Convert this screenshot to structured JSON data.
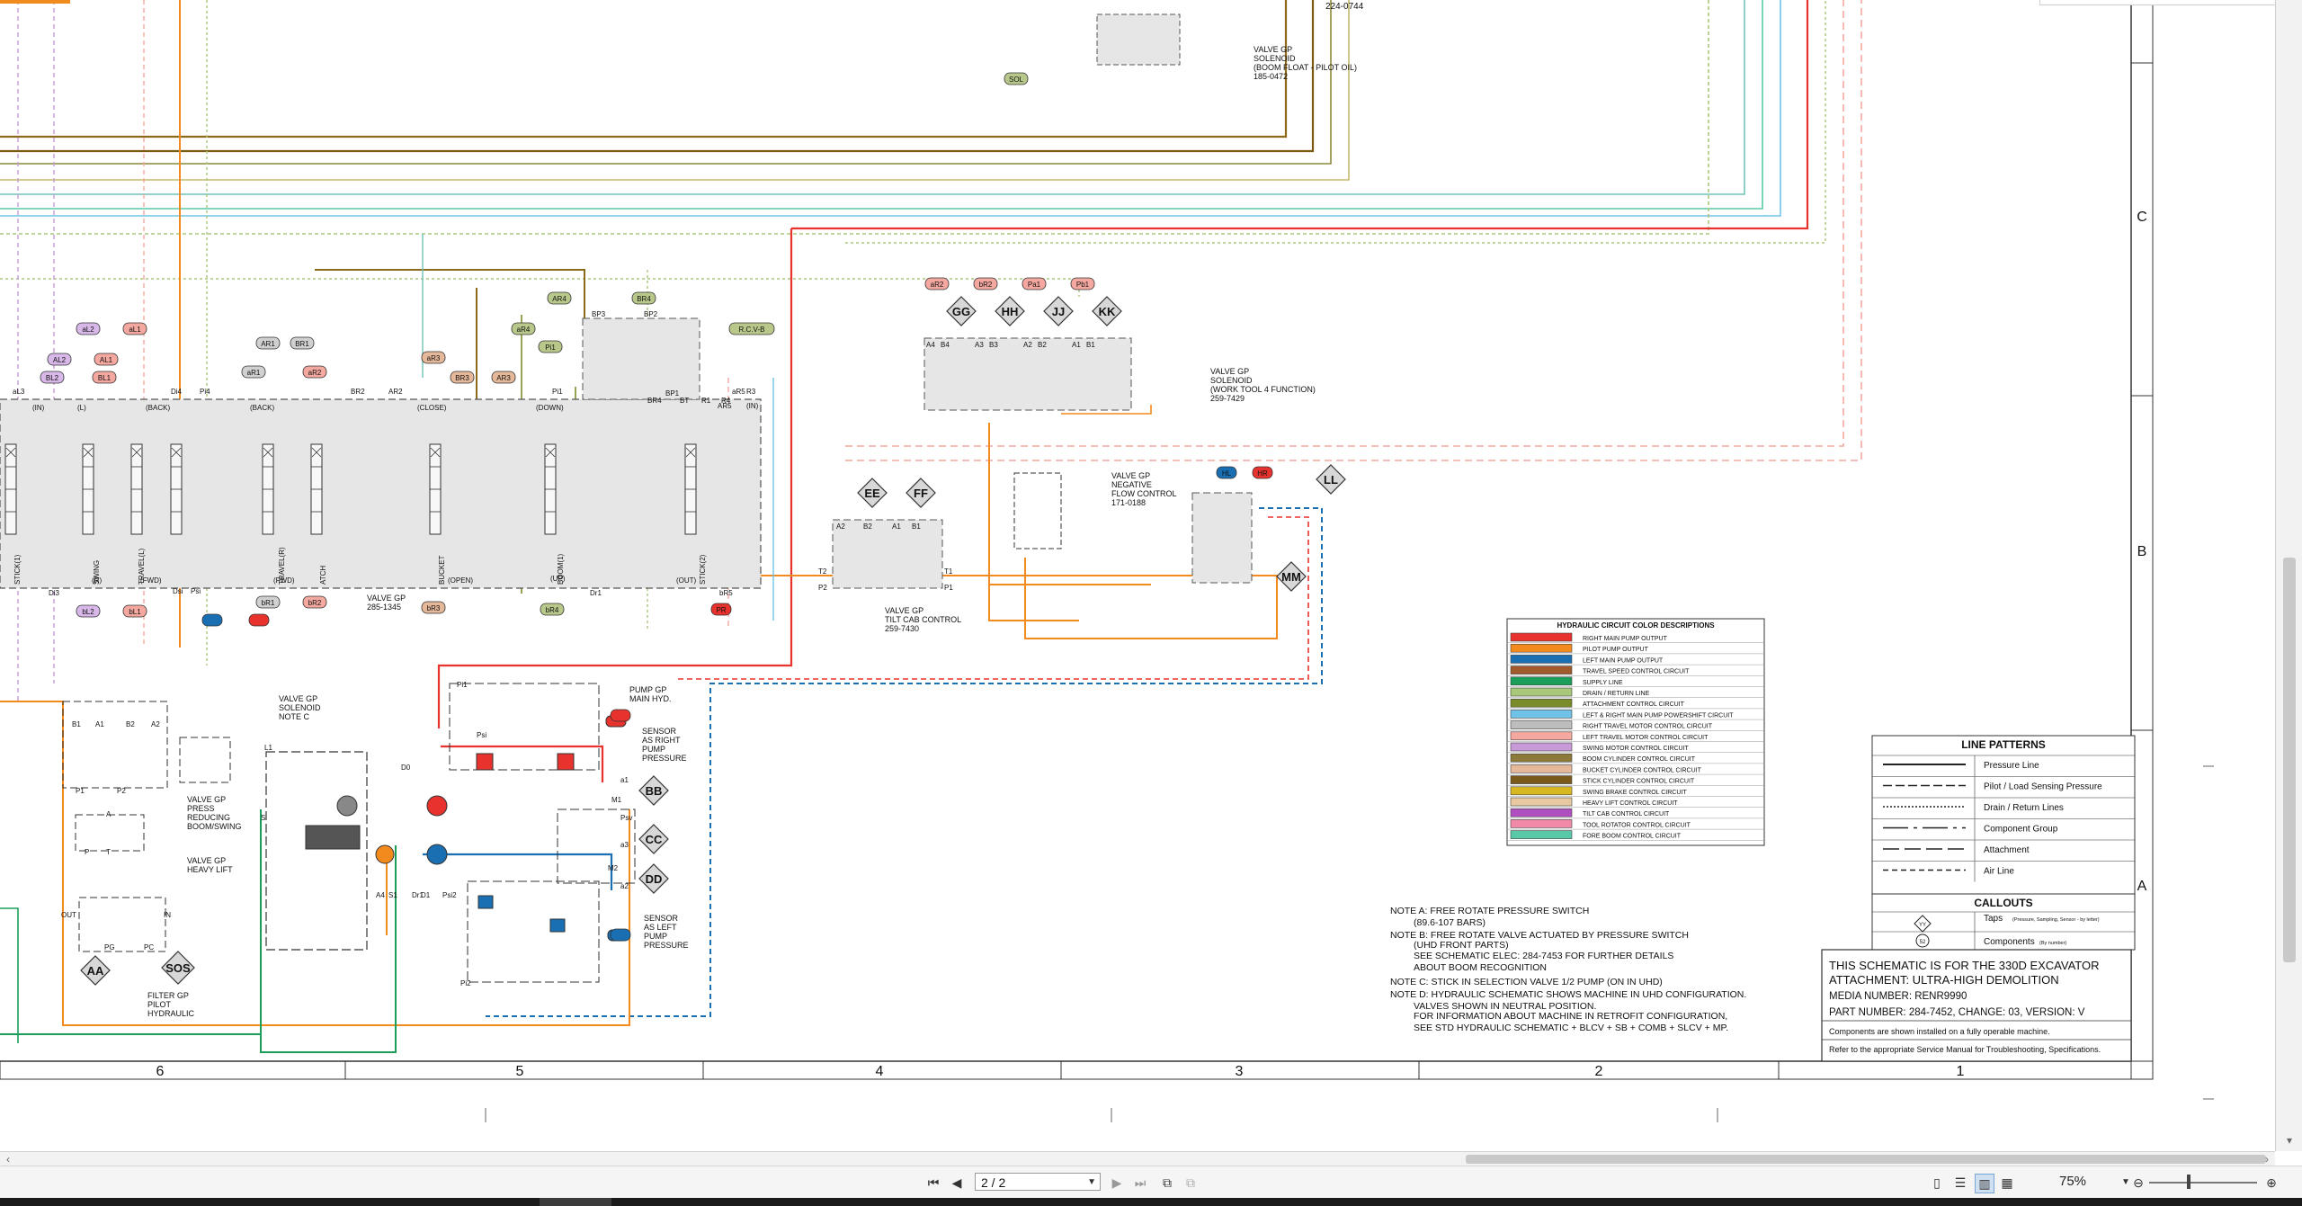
{
  "sheet": {
    "columns": [
      "6",
      "5",
      "4",
      "3",
      "2",
      "1"
    ],
    "rows": [
      "C",
      "B",
      "A"
    ],
    "part_top": "224-0744"
  },
  "components": {
    "boom_float_valve": [
      "VALVE GP",
      "SOLENOID",
      "(BOOM FLOAT - PILOT OIL)",
      "185-0472"
    ],
    "work_tool_valve": [
      "VALVE GP",
      "SOLENOID",
      "(WORK TOOL 4 FUNCTION)",
      "259-7429"
    ],
    "neg_flow_valve": [
      "VALVE GP",
      "NEGATIVE",
      "FLOW CONTROL",
      "171-0188"
    ],
    "tilt_cab_valve": [
      "VALVE GP",
      "TILT CAB CONTROL",
      "259-7430"
    ],
    "main_valve": [
      "VALVE GP",
      "285-1345"
    ],
    "solenoid_note_c": [
      "VALVE GP",
      "SOLENOID",
      "NOTE C"
    ],
    "press_reducing": [
      "VALVE GP",
      "PRESS",
      "REDUCING",
      "BOOM/SWING"
    ],
    "heavy_lift": [
      "VALVE GP",
      "HEAVY LIFT"
    ],
    "filter_pilot": [
      "FILTER GP",
      "PILOT",
      "HYDRAULIC"
    ],
    "pump_main": [
      "PUMP GP",
      "MAIN HYD."
    ],
    "sensor_right": [
      "SENSOR",
      "AS RIGHT",
      "PUMP",
      "PRESSURE"
    ],
    "sensor_left": [
      "SENSOR",
      "AS LEFT",
      "PUMP",
      "PRESSURE"
    ]
  },
  "callouts_diamond": [
    "GG",
    "HH",
    "JJ",
    "KK",
    "EE",
    "FF",
    "LL",
    "MM",
    "BB",
    "CC",
    "DD",
    "AA",
    "SOS"
  ],
  "tags": {
    "wt_top": [
      "aR2",
      "bR2",
      "Pa1",
      "Pb1"
    ],
    "wt_ports": [
      "A4",
      "B4",
      "A3",
      "B3",
      "A2",
      "B2",
      "A1",
      "B1"
    ],
    "tilt_ports": [
      "A2",
      "B2",
      "A1",
      "B1",
      "T2",
      "P2",
      "T1",
      "P1"
    ],
    "neg_top": [
      "HL",
      "HR"
    ],
    "sol": "SOL",
    "mv_top_left": [
      "aL2",
      "aL1",
      "AL2",
      "AL1",
      "BL2",
      "BL1"
    ],
    "mv_top_mid": [
      "AR1",
      "BR1",
      "aR1",
      "aR2",
      "aR3",
      "BR3",
      "AR3",
      "AR4",
      "Pi1",
      "BR4",
      "aR4",
      "R.C.V-B"
    ],
    "mv_bottom": [
      "bL2",
      "bL1",
      "bR1",
      "bR2",
      "bR3",
      "bR4",
      "PR"
    ],
    "mv_labels_top": [
      "aL3",
      "(IN)",
      "(L)",
      "(BACK)",
      "Di4",
      "Pi4",
      "(BACK)",
      "BR2",
      "AR2",
      "(CLOSE)",
      "(DOWN)",
      "Pi1",
      "BP3",
      "BP2",
      "BP1",
      "BR4",
      "BT",
      "R1",
      "R4",
      "R3",
      "AR5",
      "(IN)",
      "aR5"
    ],
    "mv_labels_bottom": [
      "Di3",
      "(R)",
      "(FWD)",
      "Dsi",
      "Psi",
      "(FWD)",
      "(OPEN)",
      "(UP)",
      "Dr1",
      "(OUT)",
      "bR5"
    ],
    "mv_spools": [
      "STICK(1)",
      "SWING",
      "TRAVEL(L)",
      "TRAVEL(R)",
      "ATCH",
      "BUCKET",
      "BOOM(1)",
      "STICK(2)"
    ],
    "pump_ports": [
      "Pi1",
      "Psi",
      "D0",
      "a1",
      "M1",
      "a3",
      "Psv",
      "M2",
      "a2",
      "A4",
      "S1",
      "Dr1",
      "D1",
      "Psi2",
      "Pi2",
      "L1",
      "S"
    ],
    "small": [
      "B1",
      "A1",
      "B2",
      "A2",
      "P1",
      "P2",
      "A",
      "T",
      "P",
      "OUT",
      "IN",
      "PC",
      "PG"
    ]
  },
  "color_table": {
    "title": "HYDRAULIC CIRCUIT COLOR DESCRIPTIONS",
    "rows": [
      {
        "label": "RIGHT MAIN PUMP OUTPUT",
        "color": "#e8322e"
      },
      {
        "label": "PILOT PUMP OUTPUT",
        "color": "#f28a1e"
      },
      {
        "label": "LEFT MAIN PUMP OUTPUT",
        "color": "#1a6fb3"
      },
      {
        "label": "TRAVEL SPEED CONTROL CIRCUIT",
        "color": "#a05a2c"
      },
      {
        "label": "SUPPLY LINE",
        "color": "#1a9e5a"
      },
      {
        "label": "DRAIN / RETURN LINE",
        "color": "#a8c87a"
      },
      {
        "label": "ATTACHMENT CONTROL CIRCUIT",
        "color": "#7a8c2a"
      },
      {
        "label": "LEFT & RIGHT MAIN PUMP POWERSHIFT CIRCUIT",
        "color": "#6fc3e8"
      },
      {
        "label": "RIGHT TRAVEL MOTOR CONTROL CIRCUIT",
        "color": "#bdbdbd"
      },
      {
        "label": "LEFT TRAVEL MOTOR CONTROL CIRCUIT",
        "color": "#f4a8a0"
      },
      {
        "label": "SWING MOTOR CONTROL CIRCUIT",
        "color": "#c89ad8"
      },
      {
        "label": "BOOM CYLINDER CONTROL CIRCUIT",
        "color": "#8c7a3a"
      },
      {
        "label": "BUCKET CYLINDER CONTROL CIRCUIT",
        "color": "#e6b89a"
      },
      {
        "label": "STICK CYLINDER CONTROL CIRCUIT",
        "color": "#7a5a1a"
      },
      {
        "label": "SWING BRAKE CONTROL CIRCUIT",
        "color": "#d8b820"
      },
      {
        "label": "HEAVY LIFT CONTROL CIRCUIT",
        "color": "#e8c8a0"
      },
      {
        "label": "TILT CAB CONTROL CIRCUIT",
        "color": "#b050c0"
      },
      {
        "label": "TOOL ROTATOR CONTROL CIRCUIT",
        "color": "#f08aa8"
      },
      {
        "label": "FORE BOOM CONTROL CIRCUIT",
        "color": "#58c8a8"
      }
    ]
  },
  "line_patterns": {
    "title": "LINE PATTERNS",
    "items": [
      "Pressure Line",
      "Pilot / Load Sensing Pressure",
      "Drain / Return Lines",
      "Component Group",
      "Attachment",
      "Air Line"
    ],
    "callouts_title": "CALLOUTS",
    "taps": "Taps",
    "taps_note": "(Pressure, Sampling, Sensor - by letter)",
    "components": "Components",
    "components_note": "(By number)",
    "symbol_yy": "YY",
    "symbol_52": "52"
  },
  "notes": [
    "NOTE A: FREE ROTATE PRESSURE SWITCH",
    "(89.6-107 BARS)",
    "NOTE B: FREE ROTATE VALVE ACTUATED BY PRESSURE SWITCH",
    "(UHD FRONT PARTS)",
    "SEE SCHEMATIC ELEC: 284-7453 FOR FURTHER DETAILS",
    "ABOUT BOOM RECOGNITION",
    "NOTE C: STICK IN SELECTION VALVE 1/2 PUMP (ON IN UHD)",
    "NOTE D: HYDRAULIC SCHEMATIC SHOWS MACHINE IN UHD CONFIGURATION.",
    "VALVES SHOWN IN NEUTRAL POSITION.",
    "FOR INFORMATION ABOUT MACHINE IN RETROFIT CONFIGURATION,",
    "SEE STD HYDRAULIC SCHEMATIC + BLCV + SB + COMB + SLCV + MP."
  ],
  "title_block": {
    "line1": "THIS SCHEMATIC IS FOR THE 330D EXCAVATOR",
    "line2": "ATTACHMENT: ULTRA-HIGH DEMOLITION",
    "line3": "MEDIA NUMBER: RENR9990",
    "line4": "PART NUMBER: 284-7452, CHANGE: 03, VERSION: V",
    "line5": "Components are shown installed on a fully operable machine.",
    "line6": "Refer to the appropriate Service Manual for Troubleshooting, Specifications."
  },
  "viewer": {
    "page_value": "2 / 2",
    "zoom": "75%"
  }
}
